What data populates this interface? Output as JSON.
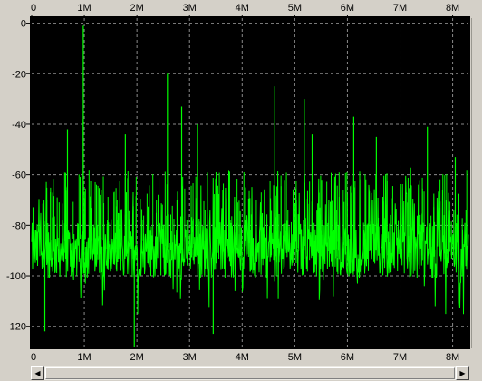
{
  "chart_data": {
    "type": "line",
    "x_axis": {
      "ticks": [
        "0",
        "1M",
        "2M",
        "3M",
        "4M",
        "5M",
        "6M",
        "7M",
        "8M"
      ],
      "tick_values": [
        0,
        1,
        2,
        3,
        4,
        5,
        6,
        7,
        8
      ],
      "range": [
        0,
        8.3
      ]
    },
    "y_axis": {
      "ticks": [
        "0",
        "-20",
        "-40",
        "-60",
        "-80",
        "-100",
        "-120"
      ],
      "tick_values": [
        0,
        -20,
        -40,
        -60,
        -80,
        -100,
        -120
      ],
      "range": [
        -128,
        2
      ]
    },
    "grid": true,
    "grid_style": "dashed",
    "background_color": "#000000",
    "grid_color": "#8a8a8a",
    "series": [
      {
        "color": "#00ff00",
        "noise_floor": -90,
        "peaks": [
          {
            "x": 0.98,
            "y": -1
          },
          {
            "x": 0.98,
            "y": -38
          },
          {
            "x": 0.68,
            "y": -42
          },
          {
            "x": 1.78,
            "y": -44
          },
          {
            "x": 2.58,
            "y": -20
          },
          {
            "x": 2.85,
            "y": -33
          },
          {
            "x": 3.15,
            "y": -40
          },
          {
            "x": 4.62,
            "y": -25
          },
          {
            "x": 5.18,
            "y": -30
          },
          {
            "x": 5.33,
            "y": -44
          },
          {
            "x": 6.12,
            "y": -37
          },
          {
            "x": 6.55,
            "y": -45
          },
          {
            "x": 7.52,
            "y": -41
          },
          {
            "x": 8.05,
            "y": -53
          },
          {
            "x": 1.95,
            "y": -128
          },
          {
            "x": 3.45,
            "y": -123
          },
          {
            "x": 0.25,
            "y": -122
          }
        ]
      }
    ]
  },
  "scrollbar": {
    "left_arrow": "◀",
    "right_arrow": "▶"
  }
}
